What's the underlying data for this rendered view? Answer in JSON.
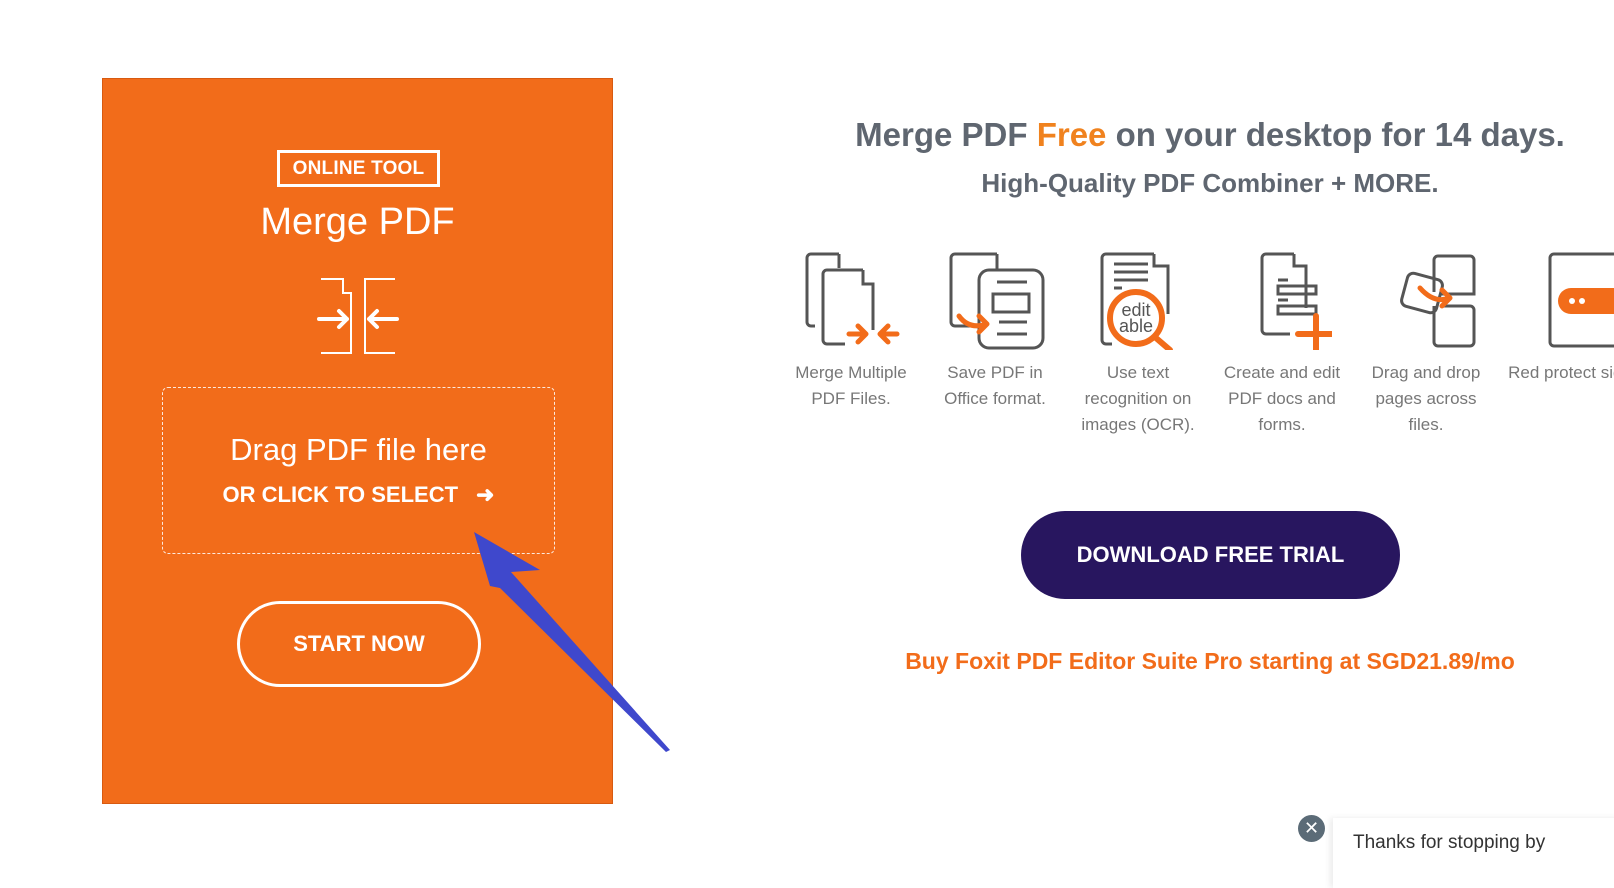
{
  "tool_card": {
    "badge": "ONLINE TOOL",
    "title": "Merge PDF",
    "icon": "merge-pages-icon",
    "drop_zone": {
      "main_text": "Drag PDF file here",
      "sub_text": "OR CLICK TO SELECT",
      "arrow_glyph": "➜"
    },
    "start_button": "START NOW",
    "background_color": "#f26c1a"
  },
  "promo": {
    "headline_before": "Merge PDF ",
    "headline_accent": "Free",
    "headline_after": " on your desktop for 14 days.",
    "subheadline": "High-Quality PDF Combiner + MORE.",
    "features": [
      {
        "icon": "merge-files-icon",
        "label": "Merge Multiple PDF Files."
      },
      {
        "icon": "save-office-icon",
        "label": "Save PDF in Office format."
      },
      {
        "icon": "ocr-editable-icon",
        "label": "Use text recognition on images (OCR)."
      },
      {
        "icon": "create-edit-icon",
        "label": "Create and edit PDF docs and forms."
      },
      {
        "icon": "drag-drop-pages-icon",
        "label": "Drag and drop pages across files."
      },
      {
        "icon": "protect-sign-icon",
        "label": "Red protect sign"
      }
    ],
    "download_button": "DOWNLOAD FREE TRIAL",
    "buy_link": "Buy Foxit PDF Editor Suite Pro starting at SGD21.89/mo",
    "accent_color": "#f0821e",
    "button_color": "#28165f"
  },
  "chat_widget": {
    "close_glyph": "✕",
    "message": "Thanks for stopping by"
  },
  "annotation": {
    "type": "arrow",
    "color": "#3f48cc",
    "points_to": "drop-zone"
  }
}
